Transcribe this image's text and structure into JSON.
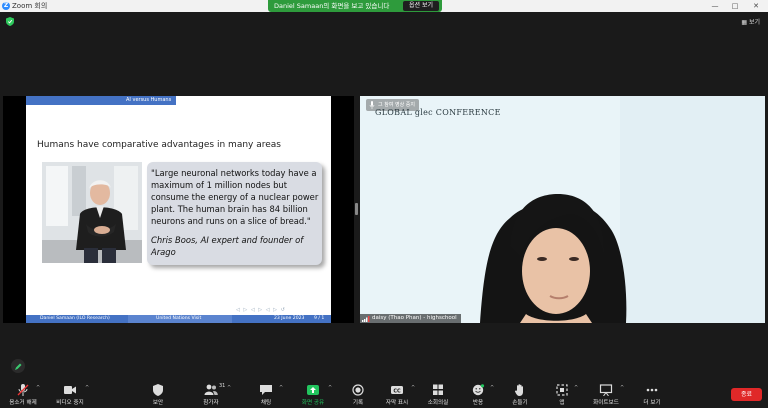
{
  "window": {
    "title": "Zoom 회의",
    "logo": "Z",
    "controls": [
      "—",
      "□",
      "✕"
    ]
  },
  "share_banner": {
    "text": "Daniel  Samaan의 화면을 보고 있습니다",
    "options_label": "옵션 보기"
  },
  "view_button": "보기",
  "slide": {
    "header_label": "AI versus Humans",
    "heading": "Humans have comparative advantages in many areas",
    "quote": "\"Large neuronal networks today have a maximum of 1 million nodes but consume the energy of a nuclear power plant.  The human brain has 84 billion neurons and runs on a slice of bread.\"",
    "author": "Chris Boos, AI expert and founder of Arago",
    "footer": {
      "presenter": "Daniel Samaan  (ILO Research)",
      "event": "United Nations Visit",
      "date": "23 June 2023",
      "page": "9 / 1"
    }
  },
  "camera": {
    "mute_label": "그 참여 영상 중지",
    "brand": "GLOBAL glec CONFERENCE",
    "participant_name": "daisy (Thao Phan) - highschool"
  },
  "toolbar": {
    "items": [
      {
        "name": "unmute-button",
        "label": "음소거 해제",
        "icon": "mic-muted-icon"
      },
      {
        "name": "video-button",
        "label": "비디오 중지",
        "icon": "video-camera-icon"
      },
      {
        "name": "security-button",
        "label": "보안",
        "icon": "shield-icon"
      },
      {
        "name": "participants-button",
        "label": "참가자",
        "icon": "participants-icon",
        "count": "31"
      },
      {
        "name": "chat-button",
        "label": "채팅",
        "icon": "chat-icon"
      },
      {
        "name": "share-screen-button",
        "label": "화면 공유",
        "icon": "share-screen-icon"
      },
      {
        "name": "record-button",
        "label": "기록",
        "icon": "record-icon"
      },
      {
        "name": "captions-button",
        "label": "자막 표시",
        "icon": "cc-icon"
      },
      {
        "name": "breakout-button",
        "label": "소회의실",
        "icon": "breakout-rooms-icon"
      },
      {
        "name": "reactions-button",
        "label": "반응",
        "icon": "smiley-icon"
      },
      {
        "name": "raise-hand-button",
        "label": "손들기",
        "icon": "hand-icon"
      },
      {
        "name": "apps-button",
        "label": "앱",
        "icon": "apps-icon"
      },
      {
        "name": "whiteboard-button",
        "label": "화이트보드",
        "icon": "whiteboard-icon"
      },
      {
        "name": "more-button",
        "label": "더 보기",
        "icon": "more-dots-icon"
      }
    ],
    "end_label": "종료"
  },
  "colors": {
    "share_green": "#2e9b3c",
    "slide_blue": "#4472c4",
    "end_red": "#e02828",
    "share_icon_green": "#22c55e"
  }
}
